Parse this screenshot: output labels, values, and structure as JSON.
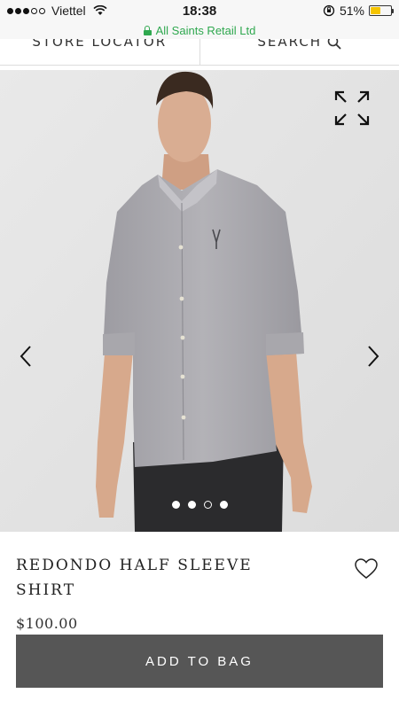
{
  "status_bar": {
    "carrier": "Viettel",
    "time": "18:38",
    "battery_percent": "51%",
    "battery_level": 0.51,
    "icons": [
      "signal-dots-icon",
      "wifi-icon",
      "orientation-lock-icon",
      "battery-icon"
    ]
  },
  "browser": {
    "site_label": "All Saints Retail Ltd",
    "secure_color": "#2fa84f"
  },
  "top_nav": {
    "store_locator": "STORE LOCATOR",
    "search": "SEARCH",
    "search_icon": "search-icon"
  },
  "gallery": {
    "image_count": 4,
    "active_index": 2,
    "icons": [
      "chevron-left-icon",
      "chevron-right-icon",
      "expand-icon"
    ]
  },
  "product": {
    "title_line1": "REDONDO HALF SLEEVE",
    "title_line2": "SHIRT",
    "price": "$100.00",
    "wishlist_icon": "heart-icon"
  },
  "actions": {
    "add_to_bag": "ADD TO BAG",
    "button_color": "#565656"
  }
}
